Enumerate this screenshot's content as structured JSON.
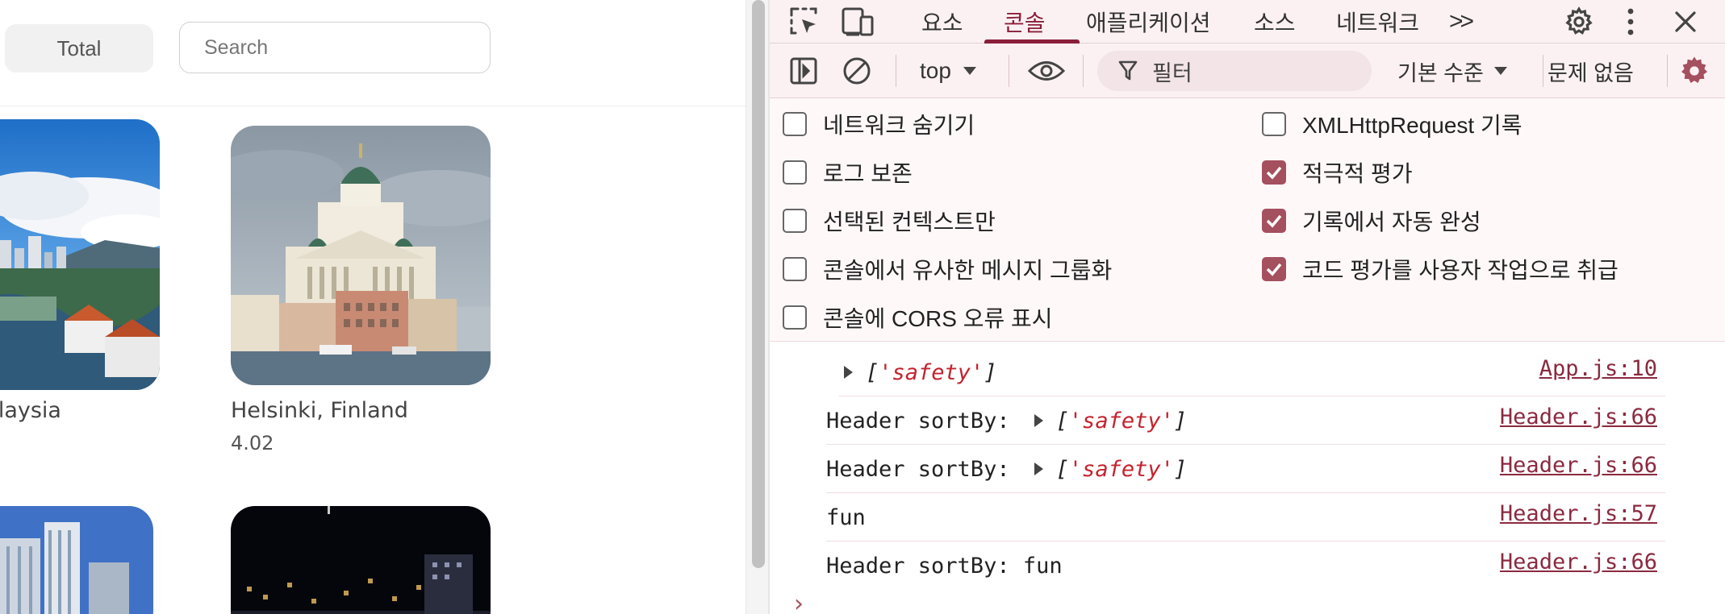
{
  "app": {
    "total_label": "Total",
    "search_placeholder": "Search",
    "cards": [
      {
        "title": "Malaysia",
        "score": ""
      },
      {
        "title": "Helsinki, Finland",
        "score": "4.02"
      }
    ]
  },
  "devtools": {
    "tabs": [
      "요소",
      "콘솔",
      "애플리케이션",
      "소스",
      "네트워크"
    ],
    "active_tab": "콘솔",
    "more_tabs": ">>",
    "context": "top",
    "filter_placeholder": "필터",
    "level": "기본 수준",
    "issues": "문제 없음",
    "settings_left": [
      {
        "label": "네트워크 숨기기",
        "checked": false
      },
      {
        "label": "로그 보존",
        "checked": false
      },
      {
        "label": "선택된 컨텍스트만",
        "checked": false
      },
      {
        "label": "콘솔에서 유사한 메시지 그룹화",
        "checked": false
      },
      {
        "label": "콘솔에 CORS 오류 표시",
        "checked": false
      }
    ],
    "settings_right": [
      {
        "label": "XMLHttpRequest 기록",
        "checked": false
      },
      {
        "label": "적극적 평가",
        "checked": true
      },
      {
        "label": "기록에서 자동 완성",
        "checked": true
      },
      {
        "label": "코드 평가를 사용자 작업으로 취급",
        "checked": true
      }
    ],
    "logs": [
      {
        "prefix": "",
        "array": "['safety']",
        "source": "App.js:10"
      },
      {
        "prefix": "Header sortBy:",
        "array": "['safety']",
        "source": "Header.js:66"
      },
      {
        "prefix": "Header sortBy:",
        "array": "['safety']",
        "source": "Header.js:66"
      },
      {
        "prefix": "fun",
        "array": "",
        "source": "Header.js:57"
      },
      {
        "prefix": "Header sortBy: fun",
        "array": "",
        "source": "Header.js:66"
      }
    ],
    "prompt": "›",
    "colors": {
      "accent": "#8a1f3a",
      "checkbox": "#a4505f",
      "string": "#c4232f"
    }
  }
}
